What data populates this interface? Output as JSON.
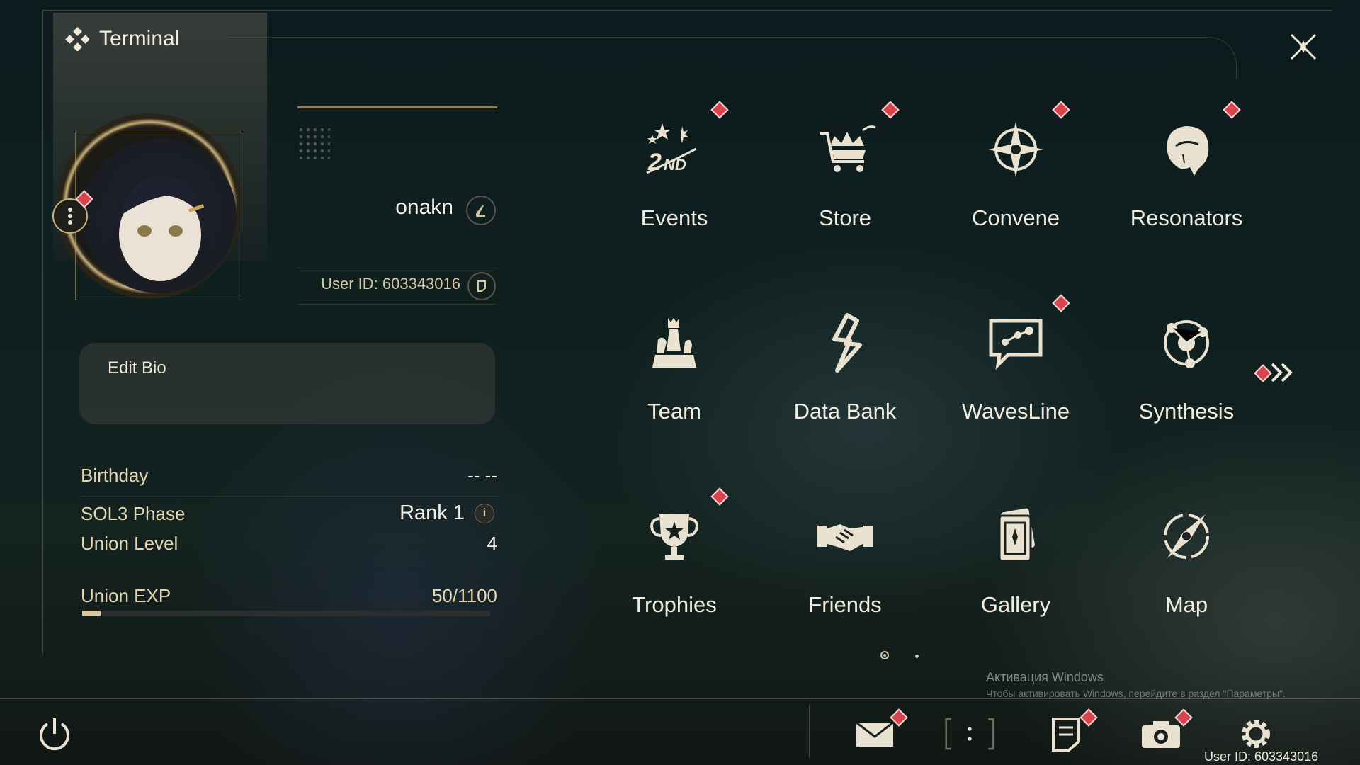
{
  "header": {
    "title": "Terminal",
    "logo_icon": "diamond-cluster-icon",
    "close_icon": "close-icon"
  },
  "profile": {
    "username": "onakn",
    "user_id_label": "User ID: 603343016",
    "bio_label": "Edit Bio",
    "stats": [
      {
        "label": "Birthday",
        "value": "-- --"
      },
      {
        "label": "SOL3 Phase",
        "value": "Rank 1"
      },
      {
        "label": "Union Level",
        "value": "4"
      },
      {
        "label": "Union EXP",
        "value": "50/1100"
      }
    ],
    "exp_fraction": 0.0455
  },
  "menu": {
    "items": [
      {
        "label": "Events",
        "icon": "events-2nd-icon",
        "badge": true
      },
      {
        "label": "Store",
        "icon": "cart-crown-icon",
        "badge": true
      },
      {
        "label": "Convene",
        "icon": "compass-star-icon",
        "badge": true
      },
      {
        "label": "Resonators",
        "icon": "character-head-icon",
        "badge": true
      },
      {
        "label": "Team",
        "icon": "chess-pieces-icon",
        "badge": false
      },
      {
        "label": "Data Bank",
        "icon": "data-bank-icon",
        "badge": false
      },
      {
        "label": "WavesLine",
        "icon": "chat-graph-icon",
        "badge": true
      },
      {
        "label": "Synthesis",
        "icon": "synthesis-orbit-icon",
        "badge": false
      },
      {
        "label": "Trophies",
        "icon": "trophy-icon",
        "badge": true
      },
      {
        "label": "Friends",
        "icon": "handshake-icon",
        "badge": false
      },
      {
        "label": "Gallery",
        "icon": "card-icon",
        "badge": false
      },
      {
        "label": "Map",
        "icon": "map-compass-icon",
        "badge": false
      }
    ],
    "page_current": 1,
    "page_total": 2
  },
  "watermark": {
    "line1": "Активация Windows",
    "line2": "Чтобы активировать Windows, перейдите в раздел \"Параметры\"."
  },
  "bottom_bar": {
    "user_id": "User ID: 603343016",
    "buttons": [
      "power-icon",
      "mail-icon",
      "bracket-colon-icon",
      "notes-icon",
      "camera-icon",
      "settings-icon"
    ]
  },
  "colors": {
    "accent_gold": "#c9b07a",
    "badge_red": "#d9434e",
    "text": "#ece6d6"
  }
}
